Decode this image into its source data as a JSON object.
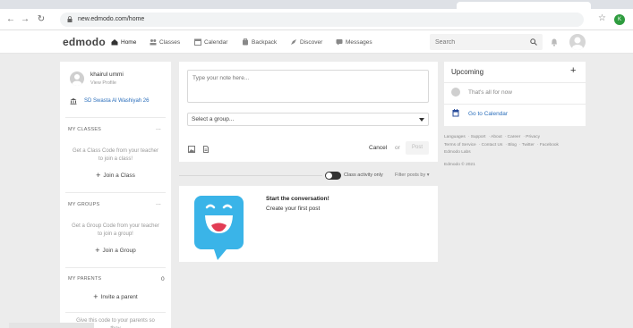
{
  "browser": {
    "url": "new.edmodo.com/home",
    "profile_initial": "K"
  },
  "nav": {
    "logo": "edmodo",
    "items": [
      {
        "label": "Home",
        "icon": "home-icon",
        "active": true
      },
      {
        "label": "Classes",
        "icon": "classes-icon"
      },
      {
        "label": "Calendar",
        "icon": "calendar-icon"
      },
      {
        "label": "Backpack",
        "icon": "backpack-icon"
      },
      {
        "label": "Discover",
        "icon": "discover-icon"
      },
      {
        "label": "Messages",
        "icon": "messages-icon"
      }
    ],
    "search_placeholder": "Search"
  },
  "profile": {
    "name": "khairul ummi",
    "view_profile": "View Profile",
    "school": "SD Swasta Al Washiyah 26"
  },
  "my_classes": {
    "title": "MY CLASSES",
    "more": "...",
    "helper": "Get a Class Code from your teacher to join a class!",
    "action": "Join a Class"
  },
  "my_groups": {
    "title": "MY GROUPS",
    "more": "...",
    "helper": "Get a Group Code from your teacher to join a group!",
    "action": "Join a Group"
  },
  "my_parents": {
    "title": "MY PARENTS",
    "count": "0",
    "action": "Invite a parent",
    "hint": "Give this code to your parents so they"
  },
  "compose": {
    "placeholder": "Type your note here...",
    "group_select": "Select a group...",
    "cancel": "Cancel",
    "or": "or",
    "post": "Post"
  },
  "filter": {
    "toggle_label": "Class activity only",
    "filter_posts": "Filter posts by"
  },
  "empty_state": {
    "title": "Start the conversation!",
    "subtitle": "Create your first post"
  },
  "upcoming": {
    "title": "Upcoming",
    "add": "+",
    "empty": "That's all for now",
    "calendar_link": "Go to Calendar"
  },
  "footer": {
    "links": [
      "Languages",
      "Support",
      "About",
      "Career",
      "Privacy",
      "Terms of Service",
      "Contact Us",
      "Blog",
      "Twitter",
      "Facebook",
      "Edmodo Labs"
    ],
    "copyright": "Edmodo © 2021"
  },
  "colors": {
    "accent_blue": "#2a6ebb",
    "bubble_blue": "#3ab4e8",
    "page_bg": "#ececec"
  }
}
